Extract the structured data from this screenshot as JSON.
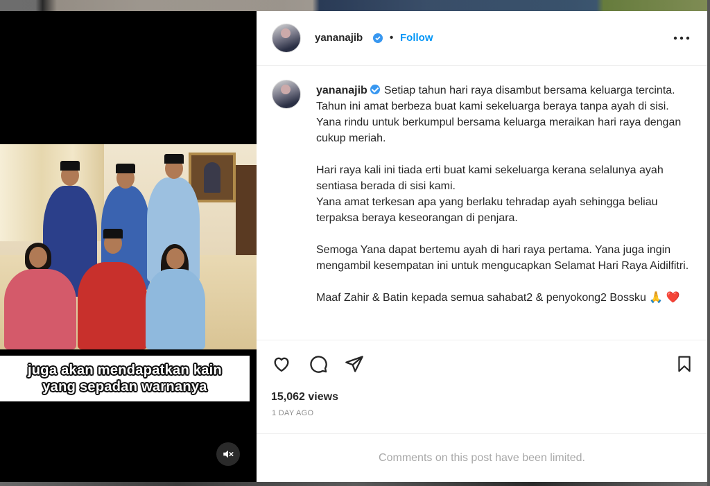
{
  "post": {
    "username": "yananajib",
    "separator": "•",
    "follow_label": "Follow",
    "caption": "Setiap tahun hari raya disambut bersama keluarga tercinta. Tahun ini amat berbeza buat kami sekeluarga beraya tanpa ayah di sisi. Yana rindu untuk berkumpul bersama keluarga meraikan hari raya dengan cukup meriah.\n\nHari raya kali ini tiada erti buat kami sekeluarga kerana selalunya ayah sentiasa berada di sisi kami.\nYana amat terkesan apa yang berlaku tehradap ayah sehingga beliau terpaksa beraya keseorangan di penjara.\n\nSemoga Yana dapat bertemu ayah di hari raya pertama. Yana juga ingin mengambil kesempatan ini untuk mengucapkan Selamat Hari Raya Aidilfitri.\n\nMaaf Zahir & Batin kepada semua sahabat2 & penyokong2 Bossku 🙏 ❤️",
    "views": "15,062 views",
    "time": "1 DAY AGO",
    "comments_limited": "Comments on this post have been limited."
  },
  "video": {
    "subtitle_line1": "juga akan mendapatkan kain",
    "subtitle_line2": "yang sepadan warnanya",
    "mute_icon": "speaker-muted-icon"
  },
  "icons": {
    "like": "heart-icon",
    "comment": "comment-bubble-icon",
    "share": "paper-plane-icon",
    "save": "bookmark-icon",
    "more": "more-horizontal-icon",
    "verified": "verified-badge-icon"
  },
  "colors": {
    "accent": "#0095f6",
    "verified": "#3897f0",
    "text": "#262626",
    "muted": "#8e8e8e"
  }
}
